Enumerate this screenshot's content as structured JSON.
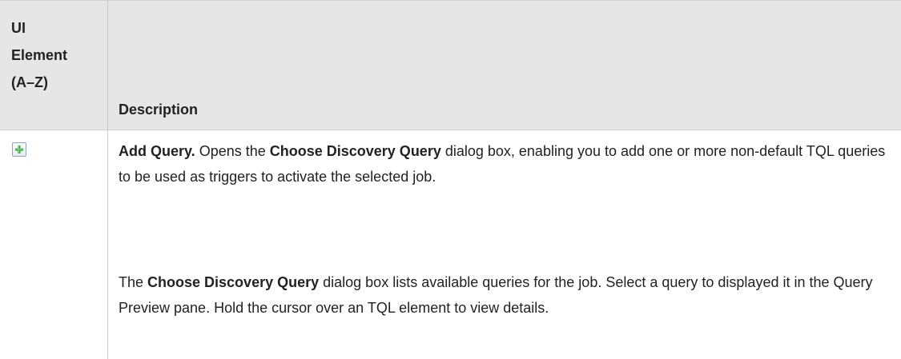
{
  "table": {
    "header": {
      "element_line1": "UI",
      "element_line2": "Element",
      "element_line3": "(A–Z)",
      "description": "Description"
    },
    "row": {
      "icon": "add-query-icon",
      "para1": {
        "bold_title": "Add Query.",
        "text_a": " Opens the ",
        "bold_dialog": "Choose Discovery Query",
        "text_b": " dialog box, enabling you to add one or more non-default TQL queries to be used as triggers to activate the selected job."
      },
      "para2": {
        "text_a": "The ",
        "bold_dialog": "Choose Discovery Query",
        "text_b": " dialog box lists available queries for the job. Select a query to displayed it in the Query Preview pane. Hold the cursor over an TQL element to view details."
      }
    }
  },
  "colors": {
    "header_bg": "#e6e6e6",
    "border": "#c8c8c8",
    "icon_green": "#3aa53a"
  }
}
